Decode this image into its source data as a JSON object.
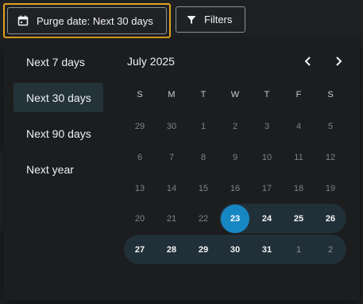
{
  "toolbar": {
    "purge_label": "Purge date: Next 30 days",
    "filters_label": "Filters"
  },
  "presets": [
    {
      "label": "Next 7 days",
      "active": false
    },
    {
      "label": "Next 30 days",
      "active": true
    },
    {
      "label": "Next 90 days",
      "active": false
    },
    {
      "label": "Next year",
      "active": false
    }
  ],
  "calendar": {
    "month_label": "July 2025",
    "weekdays": [
      "S",
      "M",
      "T",
      "W",
      "T",
      "F",
      "S"
    ],
    "weeks": [
      [
        "29",
        "30",
        "1",
        "2",
        "3",
        "4",
        "5"
      ],
      [
        "6",
        "7",
        "8",
        "9",
        "10",
        "11",
        "12"
      ],
      [
        "13",
        "14",
        "15",
        "16",
        "17",
        "18",
        "19"
      ],
      [
        "20",
        "21",
        "22",
        "23",
        "24",
        "25",
        "26"
      ],
      [
        "27",
        "28",
        "29",
        "30",
        "31",
        "1",
        "2"
      ]
    ],
    "selected_day": "23"
  },
  "colors": {
    "accent_outline": "#e0a220",
    "selected_day": "#1787c4",
    "range_band": "#213038",
    "active_preset": "#24333a"
  },
  "icons": {
    "purge": "calendar-icon",
    "filters": "filter-funnel-icon",
    "prev": "chevron-left-icon",
    "next": "chevron-right-icon"
  }
}
